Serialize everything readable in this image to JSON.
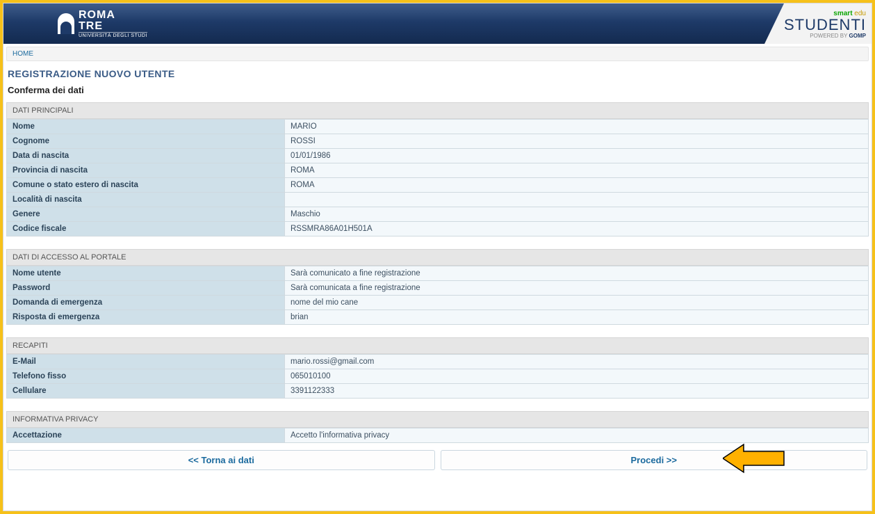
{
  "header": {
    "university_name_l1": "ROMA",
    "university_name_l2": "TRE",
    "university_name_l3": "UNIVERSITÀ DEGLI STUDI",
    "smart_label": "smart",
    "edu_label": " edu",
    "studenti_label": "STUDENTI",
    "gomp_prefix": "POWERED BY ",
    "gomp_label": "GOMP"
  },
  "breadcrumb": {
    "home": "HOME"
  },
  "titles": {
    "page": "REGISTRAZIONE NUOVO UTENTE",
    "subtitle": "Conferma dei dati"
  },
  "sections": {
    "main": {
      "header": "DATI PRINCIPALI",
      "rows": [
        {
          "label": "Nome",
          "value": "MARIO"
        },
        {
          "label": "Cognome",
          "value": "ROSSI"
        },
        {
          "label": "Data di nascita",
          "value": "01/01/1986"
        },
        {
          "label": "Provincia di nascita",
          "value": "ROMA"
        },
        {
          "label": "Comune o stato estero di nascita",
          "value": "ROMA"
        },
        {
          "label": "Località di nascita",
          "value": ""
        },
        {
          "label": "Genere",
          "value": "Maschio"
        },
        {
          "label": "Codice fiscale",
          "value": "RSSMRA86A01H501A"
        }
      ]
    },
    "access": {
      "header": "DATI DI ACCESSO AL PORTALE",
      "rows": [
        {
          "label": "Nome utente",
          "value": "Sarà comunicato a fine registrazione"
        },
        {
          "label": "Password",
          "value": "Sarà comunicata a fine registrazione"
        },
        {
          "label": "Domanda di emergenza",
          "value": "nome del mio cane"
        },
        {
          "label": "Risposta di emergenza",
          "value": "brian"
        }
      ]
    },
    "contacts": {
      "header": "RECAPITI",
      "rows": [
        {
          "label": "E-Mail",
          "value": "mario.rossi@gmail.com"
        },
        {
          "label": "Telefono fisso",
          "value": "065010100"
        },
        {
          "label": "Cellulare",
          "value": "3391122333"
        }
      ]
    },
    "privacy": {
      "header": "INFORMATIVA PRIVACY",
      "rows": [
        {
          "label": "Accettazione",
          "value": "Accetto l'informativa privacy"
        }
      ]
    }
  },
  "buttons": {
    "back": "<< Torna ai dati",
    "proceed": "Procedi >>"
  }
}
